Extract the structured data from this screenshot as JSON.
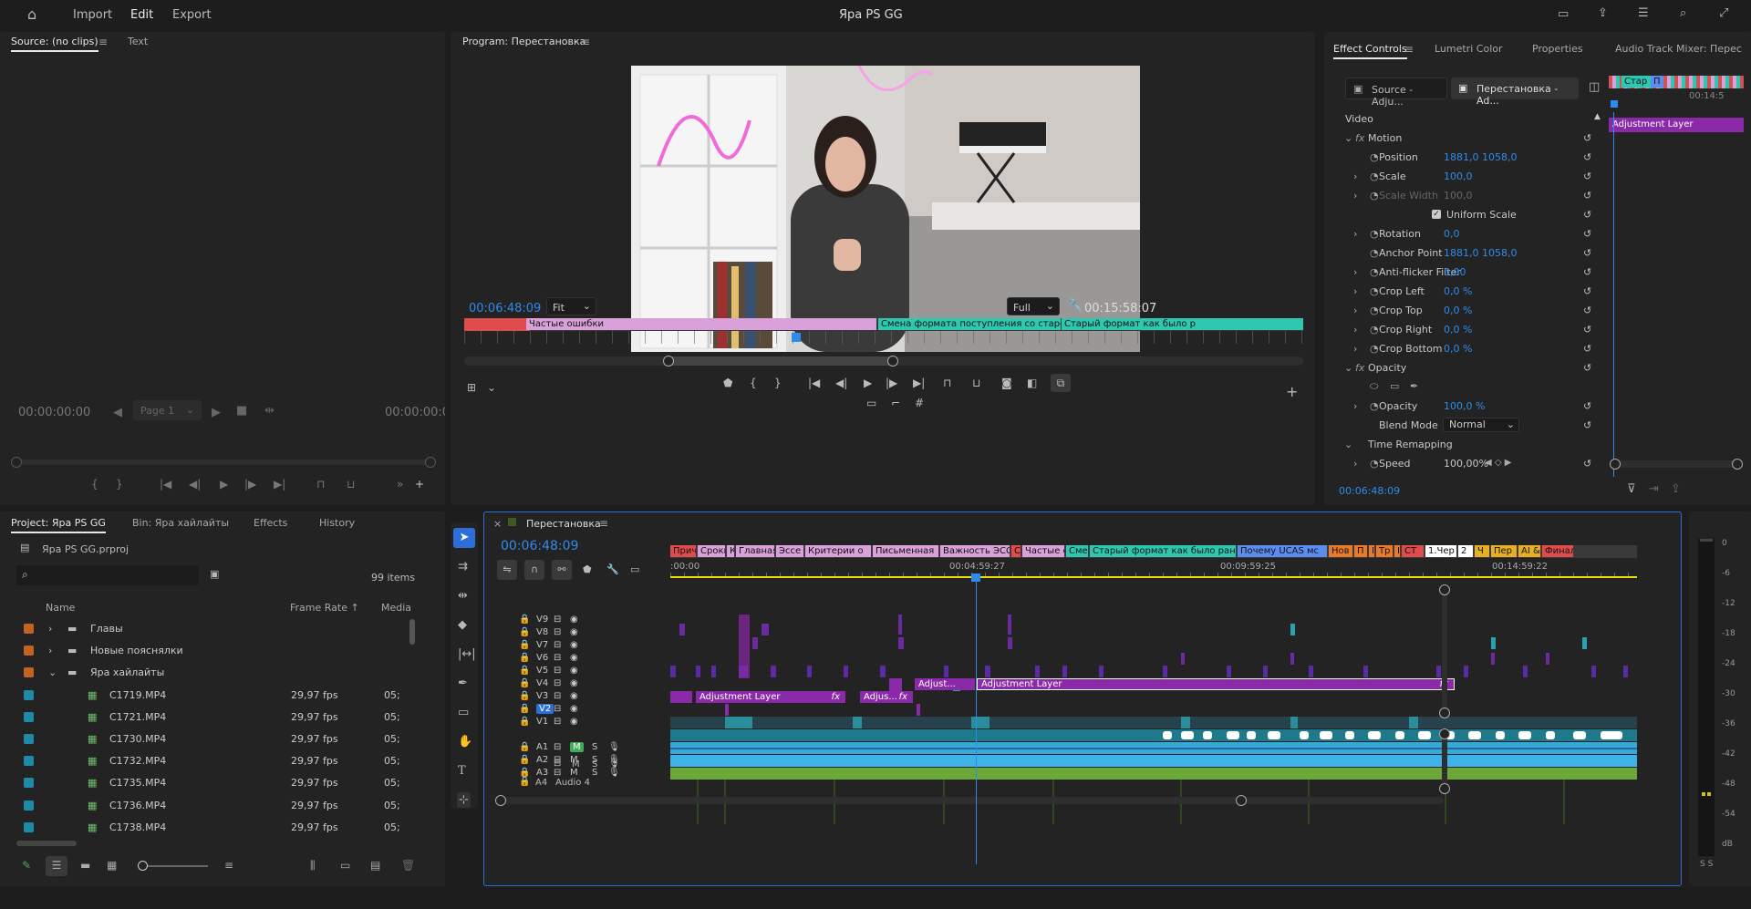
{
  "topbar": {
    "import": "Import",
    "edit": "Edit",
    "export": "Export",
    "title": "Яра PS GG"
  },
  "source": {
    "tab": "Source: (no clips)",
    "tab2": "Text",
    "tc_left": "00:00:00:00",
    "tc_right": "00:00:00:0",
    "page": "Page 1"
  },
  "program": {
    "tab": "Program: Перестановка",
    "tc": "00:06:48:09",
    "fit": "Fit",
    "full": "Full",
    "duration": "00:15:58:07",
    "markers": [
      {
        "label": "Частые ошибки",
        "color": "#d9a0d9"
      },
      {
        "label": "Смена формата поступления со старого на нов",
        "color": "#2ec7b0"
      },
      {
        "label": "Старый формат как было р",
        "color": "#2ec7b0"
      }
    ]
  },
  "effect_controls": {
    "tabs": [
      "Effect Controls",
      "Lumetri Color",
      "Properties",
      "Audio Track Mixer: Перес"
    ],
    "source_btn": "Source - Adju...",
    "seq_btn": "Перестановка - Ad...",
    "section_video": "Video",
    "mini_clip": "Adjustment Layer",
    "mini_markers": [
      "Стар",
      "П"
    ],
    "mini_tc": "00:14:5",
    "rows": [
      {
        "label": "Motion",
        "v1": "",
        "v2": ""
      },
      {
        "label": "Position",
        "v1": "1881,0",
        "v2": "1058,0"
      },
      {
        "label": "Scale",
        "v1": "100,0",
        "v2": ""
      },
      {
        "label": "Scale Width",
        "v1": "100,0",
        "v2": ""
      },
      {
        "label": "Uniform Scale",
        "v1": "",
        "v2": ""
      },
      {
        "label": "Rotation",
        "v1": "0,0",
        "v2": ""
      },
      {
        "label": "Anchor Point",
        "v1": "1881,0",
        "v2": "1058,0"
      },
      {
        "label": "Anti-flicker Filter",
        "v1": "0,00",
        "v2": ""
      },
      {
        "label": "Crop Left",
        "v1": "0,0 %",
        "v2": ""
      },
      {
        "label": "Crop Top",
        "v1": "0,0 %",
        "v2": ""
      },
      {
        "label": "Crop Right",
        "v1": "0,0 %",
        "v2": ""
      },
      {
        "label": "Crop Bottom",
        "v1": "0,0 %",
        "v2": ""
      },
      {
        "label": "Opacity",
        "v1": "",
        "v2": ""
      },
      {
        "label": "Opacity",
        "v1": "100,0 %",
        "v2": ""
      },
      {
        "label": "Blend Mode",
        "v1": "Normal",
        "v2": ""
      },
      {
        "label": "Time Remapping",
        "v1": "",
        "v2": ""
      },
      {
        "label": "Speed",
        "v1": "100,00%",
        "v2": ""
      }
    ],
    "tc": "00:06:48:09"
  },
  "project": {
    "tabs": [
      "Project: Яра PS GG",
      "Bin: Яра хайлайты",
      "Effects",
      "History"
    ],
    "file": "Яра PS GG.prproj",
    "items_count": "99 items",
    "cols": [
      "Name",
      "Frame Rate",
      "Media"
    ],
    "rows": [
      {
        "name": "Главы",
        "fps": "",
        "media": "",
        "type": "folder",
        "open": false
      },
      {
        "name": "Новые пояснялки",
        "fps": "",
        "media": "",
        "type": "folder",
        "open": false
      },
      {
        "name": "Яра хайлайты",
        "fps": "",
        "media": "",
        "type": "folder",
        "open": true
      },
      {
        "name": "C1719.MP4",
        "fps": "29,97 fps",
        "media": "05;",
        "type": "clip"
      },
      {
        "name": "C1721.MP4",
        "fps": "29,97 fps",
        "media": "05;",
        "type": "clip"
      },
      {
        "name": "C1730.MP4",
        "fps": "29,97 fps",
        "media": "05;",
        "type": "clip"
      },
      {
        "name": "C1732.MP4",
        "fps": "29,97 fps",
        "media": "05;",
        "type": "clip"
      },
      {
        "name": "C1735.MP4",
        "fps": "29,97 fps",
        "media": "05;",
        "type": "clip"
      },
      {
        "name": "C1736.MP4",
        "fps": "29,97 fps",
        "media": "05;",
        "type": "clip"
      },
      {
        "name": "C1738.MP4",
        "fps": "29,97 fps",
        "media": "05;",
        "type": "clip"
      }
    ]
  },
  "timeline": {
    "tab": "Перестановка",
    "tc": "00:06:48:09",
    "ruler": [
      ":00:00",
      "00:04:59:27",
      "00:09:59:25",
      "00:14:59:22"
    ],
    "markers": [
      {
        "label": "Прич",
        "color": "#e04b4b"
      },
      {
        "label": "Сроки",
        "color": "#d9a0d9"
      },
      {
        "label": "К",
        "color": "#d9a0d9"
      },
      {
        "label": "Главная",
        "color": "#d9a0d9"
      },
      {
        "label": "Эссе",
        "color": "#d9a0d9"
      },
      {
        "label": "Критерии о",
        "color": "#d9a0d9"
      },
      {
        "label": "Письменная",
        "color": "#d9a0d9"
      },
      {
        "label": "Важность ЭССЕ",
        "color": "#d9a0d9"
      },
      {
        "label": "С",
        "color": "#e04b4b"
      },
      {
        "label": "Частые о",
        "color": "#d9a0d9"
      },
      {
        "label": "Сме",
        "color": "#2ec7b0"
      },
      {
        "label": "Старый формат как было раньш",
        "color": "#2ec7b0"
      },
      {
        "label": "Почему UCAS мс",
        "color": "#5d8cf0"
      },
      {
        "label": "Нов",
        "color": "#e87a2a"
      },
      {
        "label": "П",
        "color": "#e87a2a"
      },
      {
        "label": "I",
        "color": "#e87a2a"
      },
      {
        "label": "Тр",
        "color": "#e87a2a"
      },
      {
        "label": "I",
        "color": "#e87a2a"
      },
      {
        "label": "СТ",
        "color": "#e04b4b"
      },
      {
        "label": "1.Чер",
        "color": "#ffffff"
      },
      {
        "label": "2",
        "color": "#ffffff"
      },
      {
        "label": "Ч",
        "color": "#e8b020"
      },
      {
        "label": "Пер",
        "color": "#e8b020"
      },
      {
        "label": "AI &",
        "color": "#e8b020"
      },
      {
        "label": "Финал",
        "color": "#e04b4b"
      }
    ],
    "tracks_video": [
      "V9",
      "V8",
      "V7",
      "V6",
      "V5",
      "V4",
      "V3",
      "V2",
      "V1"
    ],
    "tracks_audio": [
      "A1",
      "A2",
      "A3"
    ],
    "clips": [
      {
        "label": "Adjust...",
        "track": "V5"
      },
      {
        "label": "Adjustment Layer",
        "track": "V5"
      },
      {
        "label": "Adjustment Layer",
        "track": "V4"
      },
      {
        "label": "Adjus...",
        "track": "V4"
      }
    ],
    "audio4": "Audio 4",
    "audio_btns": {
      "m": "M",
      "s": "S"
    },
    "meter_labels": [
      "0",
      "-6",
      "-12",
      "-18",
      "-24",
      "-30",
      "-36",
      "-42",
      "-48",
      "-54",
      "dB"
    ],
    "meter_ss": "S S"
  }
}
